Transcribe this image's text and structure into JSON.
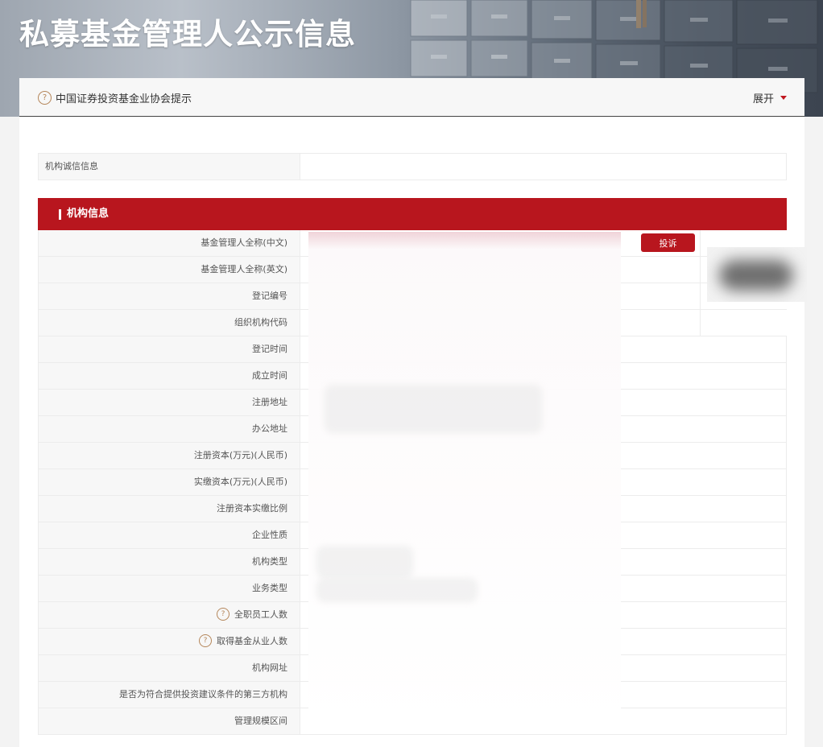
{
  "header": {
    "title": "私募基金管理人公示信息"
  },
  "notice": {
    "icon": "question-icon",
    "text": "中国证券投资基金业协会提示",
    "expand_label": "展开",
    "accent_color": "#c0171f"
  },
  "credit": {
    "label": "机构诚信信息"
  },
  "section": {
    "title": "机构信息",
    "color": "#b8161e"
  },
  "complaint_label": "投诉",
  "fields": [
    {
      "label": "基金管理人全称(中文)"
    },
    {
      "label": "基金管理人全称(英文)"
    },
    {
      "label": "登记编号"
    },
    {
      "label": "组织机构代码"
    },
    {
      "label": "登记时间"
    },
    {
      "label": "成立时间"
    },
    {
      "label": "注册地址"
    },
    {
      "label": "办公地址"
    },
    {
      "label": "注册资本(万元)(人民币)"
    },
    {
      "label": "实缴资本(万元)(人民币)"
    },
    {
      "label": "注册资本实缴比例"
    },
    {
      "label": "企业性质"
    },
    {
      "label": "机构类型"
    },
    {
      "label": "业务类型"
    },
    {
      "label": "全职员工人数",
      "help_icon": true
    },
    {
      "label": "取得基金从业人数",
      "help_icon": true
    },
    {
      "label": "机构网址"
    },
    {
      "label": "是否为符合提供投资建议条件的第三方机构"
    },
    {
      "label": "管理规模区间"
    }
  ]
}
